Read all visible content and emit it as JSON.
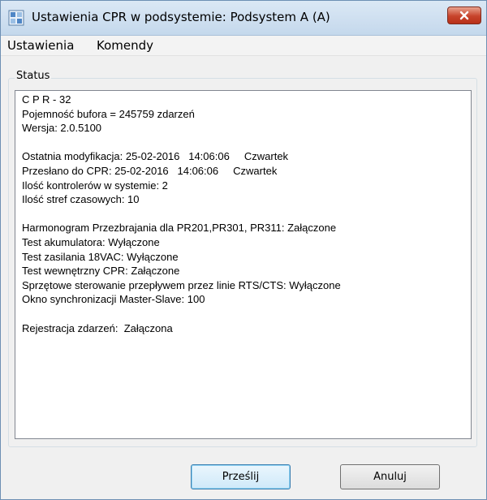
{
  "window": {
    "title": "Ustawienia CPR w podsystemie: Podsystem A (A)"
  },
  "menu": {
    "items": [
      "Ustawienia",
      "Komendy"
    ]
  },
  "status": {
    "label": "Status",
    "lines": [
      "C P R - 32",
      "Pojemność bufora = 245759 zdarzeń",
      "Wersja: 2.0.5100",
      "",
      "Ostatnia modyfikacja: 25-02-2016   14:06:06     Czwartek",
      "Przesłano do CPR: 25-02-2016   14:06:06     Czwartek",
      "Ilość kontrolerów w systemie: 2",
      "Ilość stref czasowych: 10",
      "",
      "Harmonogram Przezbrajania dla PR201,PR301, PR311: Załączone",
      "Test akumulatora: Wyłączone",
      "Test zasilania 18VAC: Wyłączone",
      "Test wewnętrzny CPR: Załączone",
      "Sprzętowe sterowanie przepływem przez linie RTS/CTS: Wyłączone",
      "Okno synchronizacji Master-Slave: 100",
      "",
      "Rejestracja zdarzeń:  Załączona"
    ]
  },
  "buttons": {
    "send": "Prześlij",
    "cancel": "Anuluj"
  }
}
